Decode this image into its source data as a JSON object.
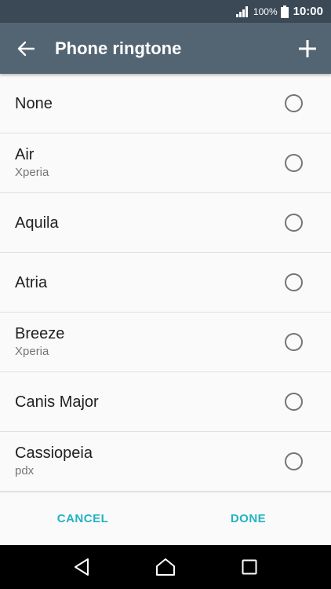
{
  "status_bar": {
    "battery_percent": "100%",
    "time": "10:00"
  },
  "app_bar": {
    "title": "Phone ringtone",
    "back_icon": "arrow-left-icon",
    "add_icon": "plus-icon"
  },
  "ringtones": [
    {
      "label": "None",
      "sub": "",
      "selected": false
    },
    {
      "label": "Air",
      "sub": "Xperia",
      "selected": false
    },
    {
      "label": "Aquila",
      "sub": "",
      "selected": false
    },
    {
      "label": "Atria",
      "sub": "",
      "selected": false
    },
    {
      "label": "Breeze",
      "sub": "Xperia",
      "selected": false
    },
    {
      "label": "Canis Major",
      "sub": "",
      "selected": false
    },
    {
      "label": "Cassiopeia",
      "sub": "pdx",
      "selected": false
    }
  ],
  "actions": {
    "cancel": "CANCEL",
    "done": "DONE"
  },
  "colors": {
    "status_bar": "#3b4956",
    "app_bar": "#536473",
    "accent": "#20b3c4"
  }
}
